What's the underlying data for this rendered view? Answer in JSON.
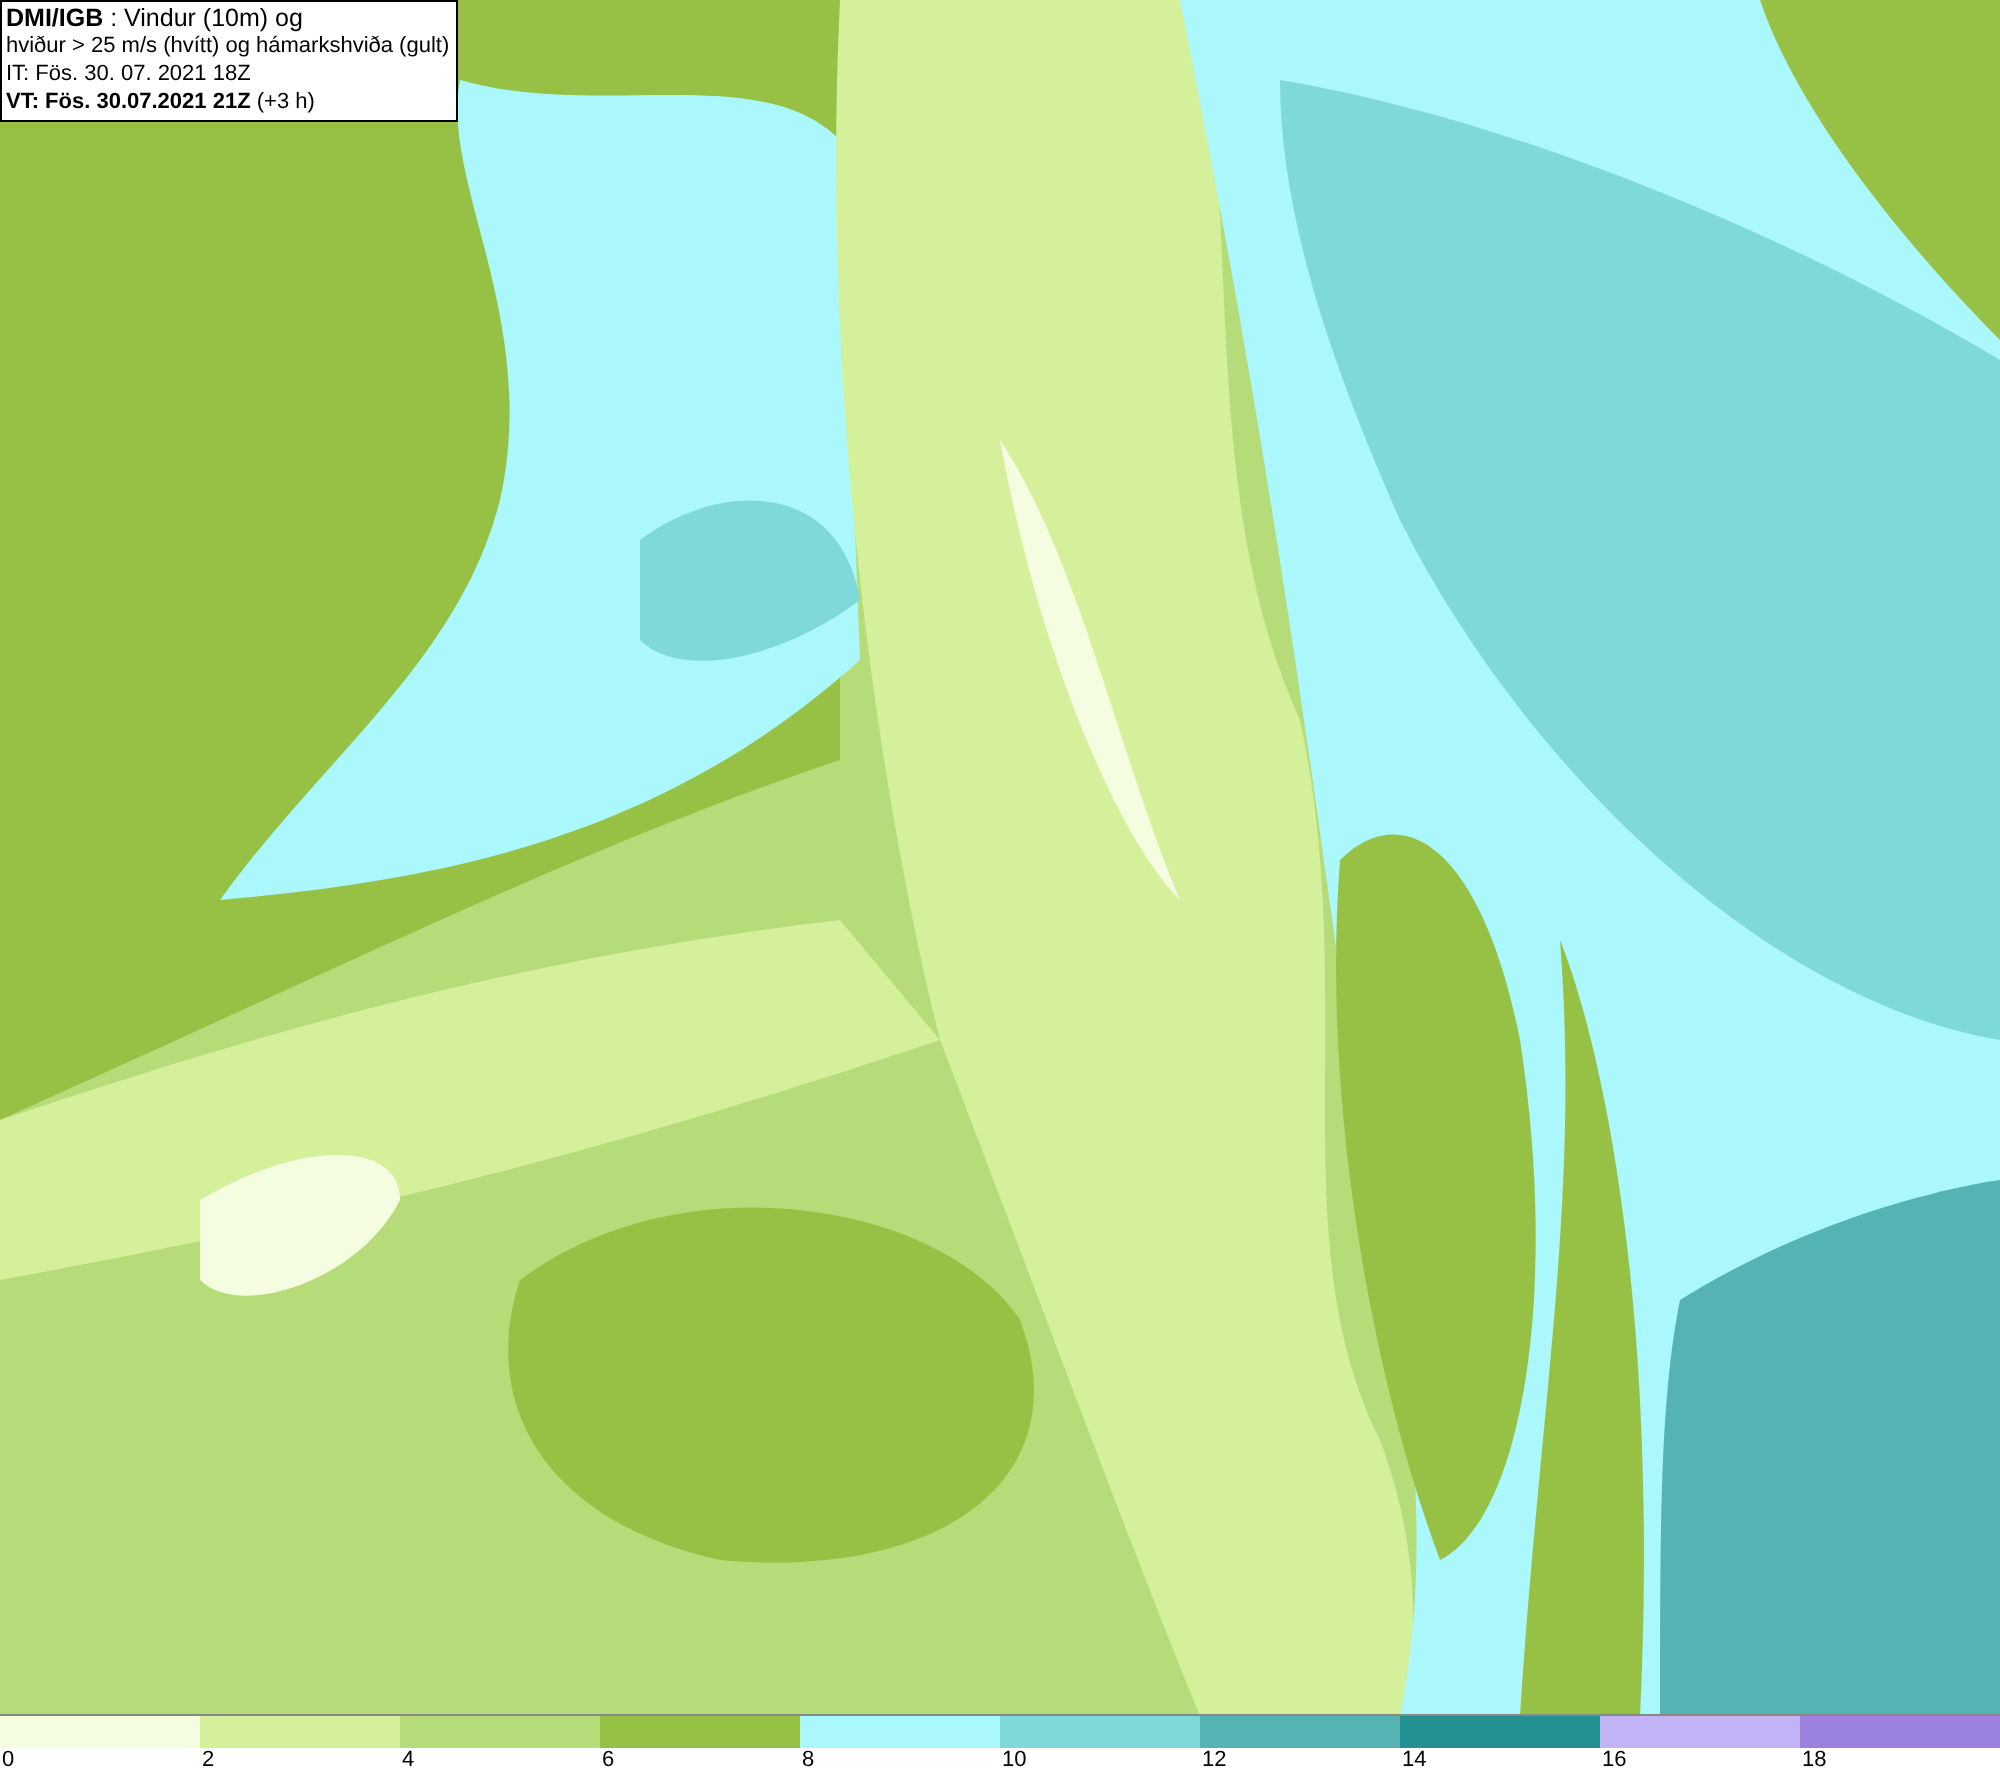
{
  "map": {
    "title_lines": [
      "**DMI/IGB** : Vindur (10m) og",
      "hviður > 25 m/s (hvítt) og hámarkshviða (gult)",
      "IT: Fös. 30. 07. 2021 18Z",
      "**VT: Fös. 30.07.2021 21Z** (+3 h)"
    ]
  },
  "legend": [
    {
      "label": "0",
      "color": "#f5fde0"
    },
    {
      "label": "2",
      "color": "#d4f09a"
    },
    {
      "label": "4",
      "color": "#b5dc78"
    },
    {
      "label": "6",
      "color": "#96c144"
    },
    {
      "label": "8",
      "color": "#aaf8fc"
    },
    {
      "label": "10",
      "color": "#80d9d9"
    },
    {
      "label": "12",
      "color": "#55b3b3"
    },
    {
      "label": "14",
      "color": "#239191"
    },
    {
      "label": "16",
      "color": "#c2b3f7"
    },
    {
      "label": "18",
      "color": "#9c82e0"
    }
  ]
}
